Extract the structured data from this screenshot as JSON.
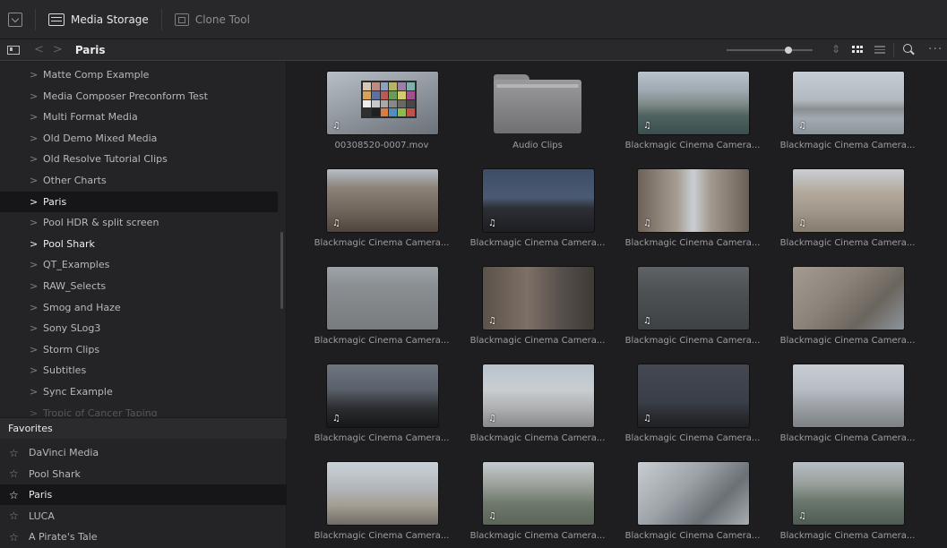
{
  "toolbar": {
    "media_storage_label": "Media Storage",
    "clone_tool_label": "Clone Tool"
  },
  "pathbar": {
    "title": "Paris",
    "zoom_level": 0.72
  },
  "tree": {
    "items": [
      {
        "label": "Matte Comp Example",
        "state": "normal"
      },
      {
        "label": "Media Composer Preconform Test",
        "state": "normal"
      },
      {
        "label": "Multi Format Media",
        "state": "normal"
      },
      {
        "label": "Old Demo Mixed Media",
        "state": "normal"
      },
      {
        "label": "Old Resolve Tutorial Clips",
        "state": "normal"
      },
      {
        "label": "Other Charts",
        "state": "normal"
      },
      {
        "label": "Paris",
        "state": "selected"
      },
      {
        "label": "Pool HDR & split screen",
        "state": "normal"
      },
      {
        "label": "Pool Shark",
        "state": "bright"
      },
      {
        "label": "QT_Examples",
        "state": "normal"
      },
      {
        "label": "RAW_Selects",
        "state": "normal"
      },
      {
        "label": "Smog and Haze",
        "state": "normal"
      },
      {
        "label": "Sony SLog3",
        "state": "normal"
      },
      {
        "label": "Storm Clips",
        "state": "normal"
      },
      {
        "label": "Subtitles",
        "state": "normal"
      },
      {
        "label": "Sync Example",
        "state": "normal"
      },
      {
        "label": "Tropic of Cancer Taping",
        "state": "faded"
      }
    ]
  },
  "favorites": {
    "header": "Favorites",
    "items": [
      {
        "label": "DaVinci Media",
        "selected": false
      },
      {
        "label": "Pool Shark",
        "selected": false
      },
      {
        "label": "Paris",
        "selected": true
      },
      {
        "label": "LUCA",
        "selected": false
      },
      {
        "label": "A Pirate's Tale",
        "selected": false
      }
    ]
  },
  "clips": [
    {
      "label": "00308520-0007.mov",
      "type": "chart",
      "audio": true
    },
    {
      "label": "Audio Clips",
      "type": "folder",
      "audio": false
    },
    {
      "label": "Blackmagic Cinema Camera...",
      "type": "river",
      "audio": true
    },
    {
      "label": "Blackmagic Cinema Camera...",
      "type": "louvre-bridge",
      "audio": true
    },
    {
      "label": "Blackmagic Cinema Camera...",
      "type": "courtyard",
      "audio": true
    },
    {
      "label": "Blackmagic Cinema Camera...",
      "type": "dusk-plaza",
      "audio": true
    },
    {
      "label": "Blackmagic Cinema Camera...",
      "type": "eiffel",
      "audio": true
    },
    {
      "label": "Blackmagic Cinema Camera...",
      "type": "facade",
      "audio": true
    },
    {
      "label": "Blackmagic Cinema Camera...",
      "type": "pavement",
      "audio": false
    },
    {
      "label": "Blackmagic Cinema Camera...",
      "type": "arcade",
      "audio": true
    },
    {
      "label": "Blackmagic Cinema Camera...",
      "type": "aerial-street",
      "audio": true
    },
    {
      "label": "Blackmagic Cinema Camera...",
      "type": "statue",
      "audio": false
    },
    {
      "label": "Blackmagic Cinema Camera...",
      "type": "trees",
      "audio": true
    },
    {
      "label": "Blackmagic Cinema Camera...",
      "type": "sacre-coeur",
      "audio": true
    },
    {
      "label": "Blackmagic Cinema Camera...",
      "type": "night-eiffel",
      "audio": true
    },
    {
      "label": "Blackmagic Cinema Camera...",
      "type": "pyramid",
      "audio": false
    },
    {
      "label": "Blackmagic Cinema Camera...",
      "type": "arch",
      "audio": false
    },
    {
      "label": "Blackmagic Cinema Camera...",
      "type": "fountain",
      "audio": true
    },
    {
      "label": "Blackmagic Cinema Camera...",
      "type": "tower-up",
      "audio": false
    },
    {
      "label": "Blackmagic Cinema Camera...",
      "type": "champ",
      "audio": true
    }
  ],
  "colors": {
    "accent_red": "#7a2426",
    "background": "#1e1e21",
    "selected_row": "#161618"
  }
}
